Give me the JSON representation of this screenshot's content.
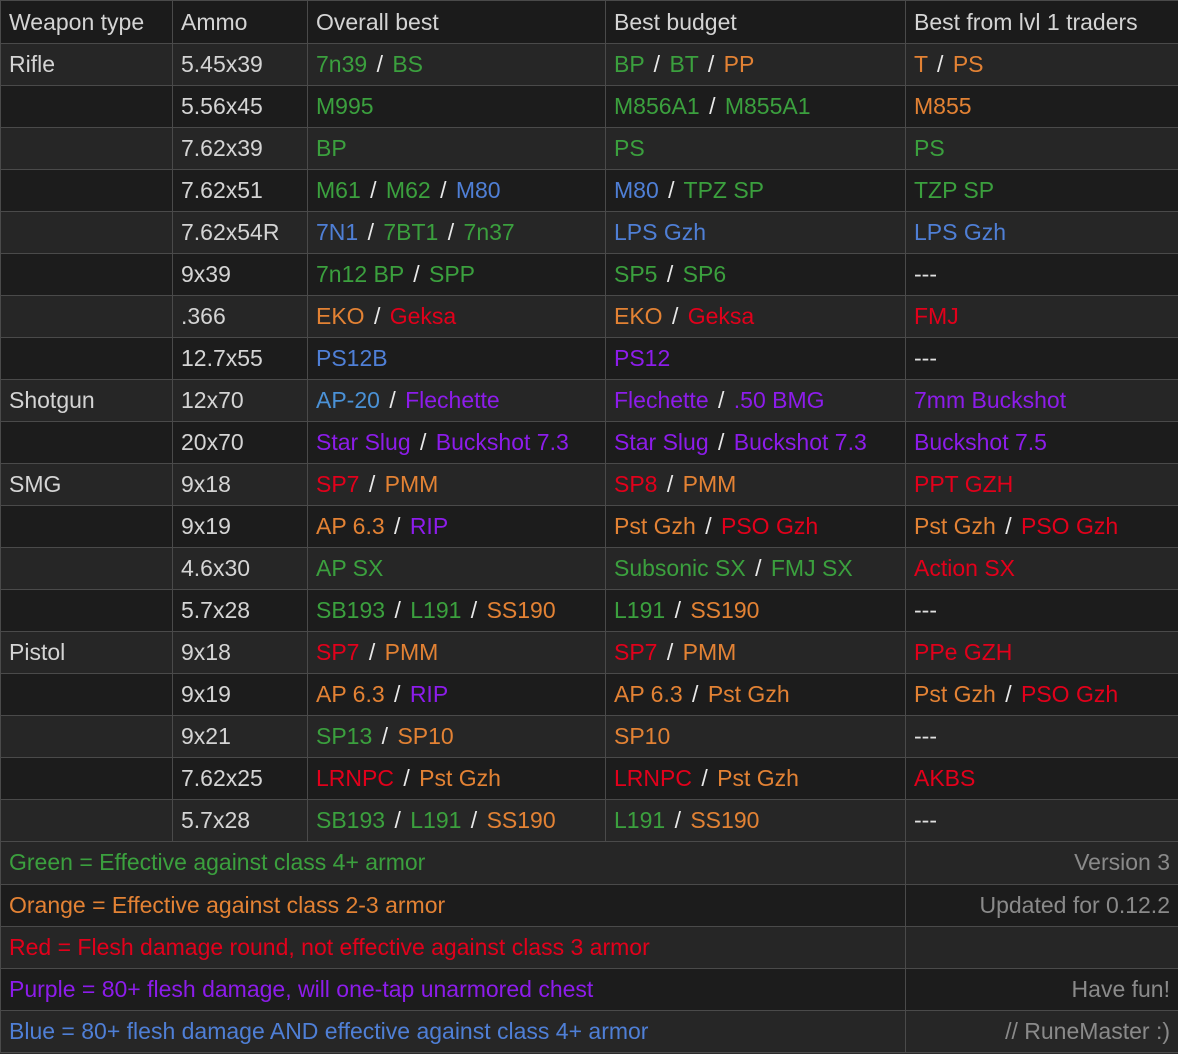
{
  "table": {
    "headers": [
      "Weapon type",
      "Ammo",
      "Overall best",
      "Best budget",
      "Best from lvl 1 traders"
    ],
    "rows": [
      {
        "weapon": "Rifle",
        "ammo": "5.45x39",
        "overall": [
          {
            "t": "7n39",
            "c": "green"
          },
          {
            "t": "/",
            "c": "sep"
          },
          {
            "t": "BS",
            "c": "green"
          }
        ],
        "budget": [
          {
            "t": "BP",
            "c": "green"
          },
          {
            "t": "/",
            "c": "sep"
          },
          {
            "t": "BT",
            "c": "green"
          },
          {
            "t": "/",
            "c": "sep"
          },
          {
            "t": "PP",
            "c": "orange"
          }
        ],
        "lvl1": [
          {
            "t": "T",
            "c": "orange"
          },
          {
            "t": "/",
            "c": "sep"
          },
          {
            "t": "PS",
            "c": "orange"
          }
        ]
      },
      {
        "weapon": "",
        "ammo": "5.56x45",
        "overall": [
          {
            "t": "M995",
            "c": "green"
          }
        ],
        "budget": [
          {
            "t": "M856A1",
            "c": "green"
          },
          {
            "t": "/",
            "c": "sep"
          },
          {
            "t": "M855A1",
            "c": "green"
          }
        ],
        "lvl1": [
          {
            "t": "M855",
            "c": "orange"
          }
        ]
      },
      {
        "weapon": "",
        "ammo": "7.62x39",
        "overall": [
          {
            "t": "BP",
            "c": "green"
          }
        ],
        "budget": [
          {
            "t": "PS",
            "c": "green"
          }
        ],
        "lvl1": [
          {
            "t": "PS",
            "c": "green"
          }
        ]
      },
      {
        "weapon": "",
        "ammo": "7.62x51",
        "overall": [
          {
            "t": "M61",
            "c": "green"
          },
          {
            "t": "/",
            "c": "sep"
          },
          {
            "t": "M62",
            "c": "green"
          },
          {
            "t": "/",
            "c": "sep"
          },
          {
            "t": "M80",
            "c": "blue"
          }
        ],
        "budget": [
          {
            "t": "M80",
            "c": "blue"
          },
          {
            "t": "/",
            "c": "sep"
          },
          {
            "t": "TPZ SP",
            "c": "green"
          }
        ],
        "lvl1": [
          {
            "t": "TZP SP",
            "c": "green"
          }
        ]
      },
      {
        "weapon": "",
        "ammo": "7.62x54R",
        "overall": [
          {
            "t": "7N1",
            "c": "blue"
          },
          {
            "t": "/",
            "c": "sep"
          },
          {
            "t": "7BT1",
            "c": "green"
          },
          {
            "t": "/",
            "c": "sep"
          },
          {
            "t": "7n37",
            "c": "green"
          }
        ],
        "budget": [
          {
            "t": "LPS Gzh",
            "c": "blue"
          }
        ],
        "lvl1": [
          {
            "t": "LPS Gzh",
            "c": "blue"
          }
        ]
      },
      {
        "weapon": "",
        "ammo": "9x39",
        "overall": [
          {
            "t": "7n12 BP",
            "c": "green"
          },
          {
            "t": "/",
            "c": "sep"
          },
          {
            "t": "SPP",
            "c": "green"
          }
        ],
        "budget": [
          {
            "t": "SP5",
            "c": "green"
          },
          {
            "t": "/",
            "c": "sep"
          },
          {
            "t": "SP6",
            "c": "green"
          }
        ],
        "lvl1": [
          {
            "t": "---",
            "c": "dash"
          }
        ]
      },
      {
        "weapon": "",
        "ammo": ".366",
        "overall": [
          {
            "t": "EKO",
            "c": "orange"
          },
          {
            "t": "/",
            "c": "sep"
          },
          {
            "t": "Geksa",
            "c": "red"
          }
        ],
        "budget": [
          {
            "t": "EKO",
            "c": "orange"
          },
          {
            "t": "/",
            "c": "sep"
          },
          {
            "t": "Geksa",
            "c": "red"
          }
        ],
        "lvl1": [
          {
            "t": "FMJ",
            "c": "red"
          }
        ]
      },
      {
        "weapon": "",
        "ammo": "12.7x55",
        "overall": [
          {
            "t": "PS12B",
            "c": "blue"
          }
        ],
        "budget": [
          {
            "t": "PS12",
            "c": "purple"
          }
        ],
        "lvl1": [
          {
            "t": "---",
            "c": "dash"
          }
        ]
      },
      {
        "weapon": "Shotgun",
        "ammo": "12x70",
        "overall": [
          {
            "t": "AP-20",
            "c": "ltblue"
          },
          {
            "t": "/",
            "c": "sep"
          },
          {
            "t": "Flechette",
            "c": "purple"
          }
        ],
        "budget": [
          {
            "t": "Flechette",
            "c": "purple"
          },
          {
            "t": "/",
            "c": "sep"
          },
          {
            "t": ".50 BMG",
            "c": "purple"
          }
        ],
        "lvl1": [
          {
            "t": "7mm Buckshot",
            "c": "purple"
          }
        ]
      },
      {
        "weapon": "",
        "ammo": "20x70",
        "overall": [
          {
            "t": "Star Slug",
            "c": "purple"
          },
          {
            "t": "/",
            "c": "sep"
          },
          {
            "t": "Buckshot 7.3",
            "c": "purple"
          }
        ],
        "budget": [
          {
            "t": "Star Slug",
            "c": "purple"
          },
          {
            "t": "/",
            "c": "sep"
          },
          {
            "t": "Buckshot 7.3",
            "c": "purple"
          }
        ],
        "lvl1": [
          {
            "t": "Buckshot 7.5",
            "c": "purple"
          }
        ]
      },
      {
        "weapon": "SMG",
        "ammo": "9x18",
        "overall": [
          {
            "t": "SP7",
            "c": "red"
          },
          {
            "t": "/",
            "c": "sep"
          },
          {
            "t": "PMM",
            "c": "orange"
          }
        ],
        "budget": [
          {
            "t": "SP8",
            "c": "red"
          },
          {
            "t": "/",
            "c": "sep"
          },
          {
            "t": "PMM",
            "c": "orange"
          }
        ],
        "lvl1": [
          {
            "t": "PPT GZH",
            "c": "red"
          }
        ]
      },
      {
        "weapon": "",
        "ammo": "9x19",
        "overall": [
          {
            "t": "AP 6.3",
            "c": "orange"
          },
          {
            "t": "/",
            "c": "sep"
          },
          {
            "t": "RIP",
            "c": "purple"
          }
        ],
        "budget": [
          {
            "t": "Pst Gzh",
            "c": "orange"
          },
          {
            "t": "/",
            "c": "sep"
          },
          {
            "t": "PSO Gzh",
            "c": "red"
          }
        ],
        "lvl1": [
          {
            "t": "Pst Gzh",
            "c": "orange"
          },
          {
            "t": "/",
            "c": "sep"
          },
          {
            "t": "PSO Gzh",
            "c": "red"
          }
        ]
      },
      {
        "weapon": "",
        "ammo": "4.6x30",
        "overall": [
          {
            "t": "AP SX",
            "c": "green"
          }
        ],
        "budget": [
          {
            "t": "Subsonic SX",
            "c": "green"
          },
          {
            "t": "/",
            "c": "sep"
          },
          {
            "t": "FMJ SX",
            "c": "green"
          }
        ],
        "lvl1": [
          {
            "t": "Action SX",
            "c": "red"
          }
        ]
      },
      {
        "weapon": "",
        "ammo": "5.7x28",
        "overall": [
          {
            "t": "SB193",
            "c": "green"
          },
          {
            "t": "/",
            "c": "sep"
          },
          {
            "t": "L191",
            "c": "green"
          },
          {
            "t": "/",
            "c": "sep"
          },
          {
            "t": "SS190",
            "c": "orange"
          }
        ],
        "budget": [
          {
            "t": "L191",
            "c": "green"
          },
          {
            "t": "/",
            "c": "sep"
          },
          {
            "t": "SS190",
            "c": "orange"
          }
        ],
        "lvl1": [
          {
            "t": "---",
            "c": "dash"
          }
        ]
      },
      {
        "weapon": "Pistol",
        "ammo": "9x18",
        "overall": [
          {
            "t": "SP7",
            "c": "red"
          },
          {
            "t": "/",
            "c": "sep"
          },
          {
            "t": "PMM",
            "c": "orange"
          }
        ],
        "budget": [
          {
            "t": "SP7",
            "c": "red"
          },
          {
            "t": "/",
            "c": "sep"
          },
          {
            "t": "PMM",
            "c": "orange"
          }
        ],
        "lvl1": [
          {
            "t": "PPe GZH",
            "c": "red"
          }
        ]
      },
      {
        "weapon": "",
        "ammo": "9x19",
        "overall": [
          {
            "t": "AP 6.3",
            "c": "orange"
          },
          {
            "t": "/",
            "c": "sep"
          },
          {
            "t": "RIP",
            "c": "purple"
          }
        ],
        "budget": [
          {
            "t": "AP 6.3",
            "c": "orange"
          },
          {
            "t": "/",
            "c": "sep"
          },
          {
            "t": "Pst Gzh",
            "c": "orange"
          }
        ],
        "lvl1": [
          {
            "t": "Pst Gzh",
            "c": "orange"
          },
          {
            "t": "/",
            "c": "sep"
          },
          {
            "t": "PSO Gzh",
            "c": "red"
          }
        ]
      },
      {
        "weapon": "",
        "ammo": "9x21",
        "overall": [
          {
            "t": "SP13",
            "c": "green"
          },
          {
            "t": "/",
            "c": "sep"
          },
          {
            "t": "SP10",
            "c": "orange"
          }
        ],
        "budget": [
          {
            "t": "SP10",
            "c": "orange"
          }
        ],
        "lvl1": [
          {
            "t": "---",
            "c": "dash"
          }
        ]
      },
      {
        "weapon": "",
        "ammo": "7.62x25",
        "overall": [
          {
            "t": "LRNPC",
            "c": "red"
          },
          {
            "t": "/",
            "c": "sep"
          },
          {
            "t": "Pst Gzh",
            "c": "orange"
          }
        ],
        "budget": [
          {
            "t": "LRNPC",
            "c": "red"
          },
          {
            "t": "/",
            "c": "sep"
          },
          {
            "t": "Pst Gzh",
            "c": "orange"
          }
        ],
        "lvl1": [
          {
            "t": "AKBS",
            "c": "red"
          }
        ]
      },
      {
        "weapon": "",
        "ammo": "5.7x28",
        "overall": [
          {
            "t": "SB193",
            "c": "green"
          },
          {
            "t": "/",
            "c": "sep"
          },
          {
            "t": "L191",
            "c": "green"
          },
          {
            "t": "/",
            "c": "sep"
          },
          {
            "t": "SS190",
            "c": "orange"
          }
        ],
        "budget": [
          {
            "t": "L191",
            "c": "green"
          },
          {
            "t": "/",
            "c": "sep"
          },
          {
            "t": "SS190",
            "c": "orange"
          }
        ],
        "lvl1": [
          {
            "t": "---",
            "c": "dash"
          }
        ]
      }
    ]
  },
  "legend": {
    "rows": [
      {
        "text": "Green = Effective against class 4+ armor",
        "color": "green",
        "meta": "Version 3"
      },
      {
        "text": "Orange = Effective against class 2-3 armor",
        "color": "orange",
        "meta": "Updated for 0.12.2"
      },
      {
        "text": "Red = Flesh damage round, not effective against class 3 armor",
        "color": "red",
        "meta": ""
      },
      {
        "text": "Purple = 80+ flesh damage, will one-tap unarmored chest",
        "color": "purple",
        "meta": "Have fun!"
      },
      {
        "text": "Blue = 80+ flesh damage AND effective against class 4+ armor",
        "color": "blue",
        "meta": "// RuneMaster :)"
      }
    ]
  },
  "colors": {
    "green": "#3ba03e",
    "orange": "#e38234",
    "red": "#e2001b",
    "purple": "#8d1ceb",
    "blue": "#4f7fd6",
    "ltblue": "#4a91d6",
    "grey": "#8a8a8a",
    "background": "#1c1c1c",
    "row_alt": "#262626",
    "border": "#4a4a4a"
  }
}
